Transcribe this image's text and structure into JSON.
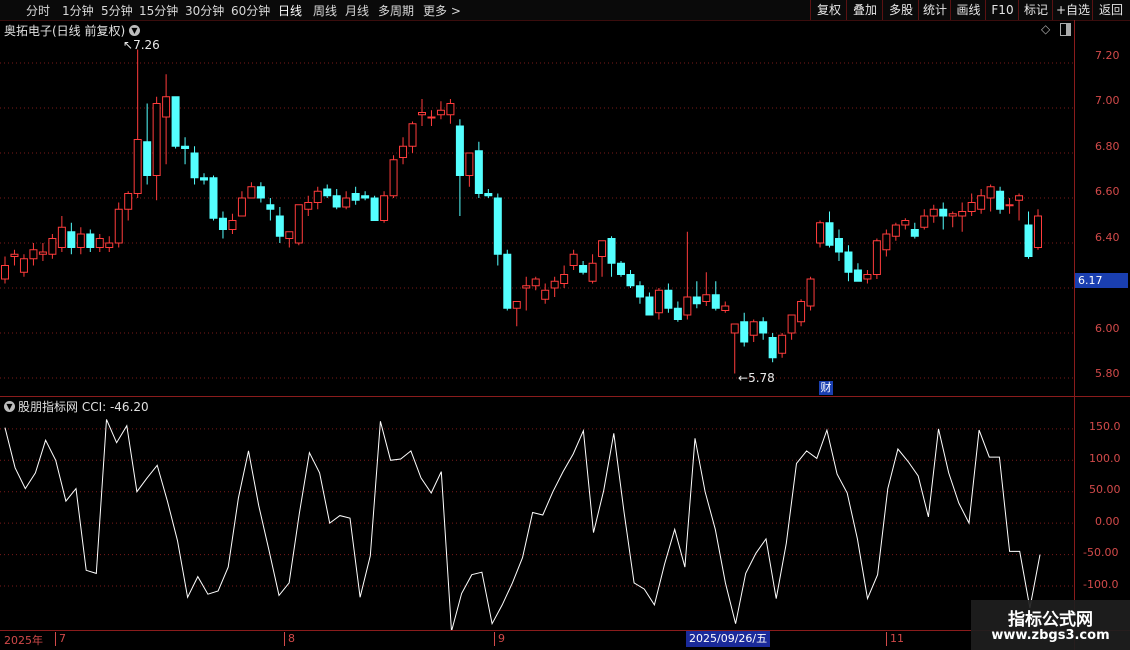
{
  "toolbar": {
    "timeframes": [
      "分时",
      "1分钟",
      "5分钟",
      "15分钟",
      "30分钟",
      "60分钟",
      "日线",
      "周线",
      "月线",
      "多周期",
      "更多 >"
    ],
    "active_timeframe": "日线",
    "right_buttons": [
      "复权",
      "叠加",
      "多股",
      "统计",
      "画线",
      "F10",
      "标记",
      "+自选",
      "返回"
    ]
  },
  "stock_title": "奥拓电子(日线 前复权)",
  "indicator_title": "股朋指标网  CCI: -46.20",
  "high_marker": "7.26",
  "low_marker": "5.78",
  "current_price_tag": "6.17",
  "fin_badge": "财",
  "price_axis_labels": [
    "7.20",
    "7.00",
    "6.80",
    "6.60",
    "6.40",
    "6.20",
    "6.00",
    "5.80"
  ],
  "cci_axis_labels": [
    "150.0",
    "100.0",
    "50.00",
    "0.00",
    "-50.00",
    "-100.0"
  ],
  "date_bar": {
    "year": "2025年",
    "months": [
      "7",
      "8",
      "9",
      "11"
    ],
    "highlight_date": "2025/09/26/五"
  },
  "watermark": {
    "line1": "指标公式网",
    "line2": "www.zbgs3.com"
  },
  "colors": {
    "up": "#ff3c3c",
    "down": "#54ffff",
    "cci": "#ffffff",
    "grid": "#7a1a1a"
  },
  "chart_data": [
    {
      "type": "candlestick",
      "title": "奥拓电子(日线 前复权)",
      "ylim": [
        5.72,
        7.32
      ],
      "annotations": [
        {
          "label": "7.26",
          "kind": "high"
        },
        {
          "label": "5.78",
          "kind": "low"
        }
      ],
      "candles": [
        [
          6.24,
          6.34,
          6.22,
          6.3
        ],
        [
          6.34,
          6.37,
          6.3,
          6.35
        ],
        [
          6.27,
          6.35,
          6.25,
          6.33
        ],
        [
          6.33,
          6.4,
          6.3,
          6.37
        ],
        [
          6.35,
          6.4,
          6.32,
          6.36
        ],
        [
          6.35,
          6.44,
          6.33,
          6.42
        ],
        [
          6.38,
          6.52,
          6.36,
          6.47
        ],
        [
          6.45,
          6.49,
          6.35,
          6.38
        ],
        [
          6.38,
          6.47,
          6.35,
          6.44
        ],
        [
          6.44,
          6.46,
          6.36,
          6.38
        ],
        [
          6.38,
          6.44,
          6.36,
          6.42
        ],
        [
          6.38,
          6.43,
          6.36,
          6.4
        ],
        [
          6.4,
          6.58,
          6.38,
          6.55
        ],
        [
          6.55,
          6.63,
          6.5,
          6.62
        ],
        [
          6.62,
          7.26,
          6.6,
          6.86
        ],
        [
          6.85,
          7.02,
          6.66,
          6.7
        ],
        [
          6.7,
          7.05,
          6.59,
          7.02
        ],
        [
          6.96,
          7.15,
          6.75,
          7.05
        ],
        [
          7.05,
          7.05,
          6.82,
          6.83
        ],
        [
          6.83,
          6.87,
          6.75,
          6.82
        ],
        [
          6.8,
          6.83,
          6.66,
          6.69
        ],
        [
          6.69,
          6.71,
          6.66,
          6.68
        ],
        [
          6.69,
          6.7,
          6.5,
          6.51
        ],
        [
          6.51,
          6.54,
          6.42,
          6.46
        ],
        [
          6.46,
          6.53,
          6.44,
          6.5
        ],
        [
          6.52,
          6.63,
          6.52,
          6.6
        ],
        [
          6.6,
          6.67,
          6.6,
          6.65
        ],
        [
          6.65,
          6.67,
          6.58,
          6.6
        ],
        [
          6.57,
          6.6,
          6.5,
          6.55
        ],
        [
          6.52,
          6.56,
          6.4,
          6.43
        ],
        [
          6.42,
          6.45,
          6.38,
          6.45
        ],
        [
          6.4,
          6.55,
          6.39,
          6.57
        ],
        [
          6.55,
          6.61,
          6.52,
          6.58
        ],
        [
          6.58,
          6.65,
          6.55,
          6.63
        ],
        [
          6.64,
          6.66,
          6.6,
          6.61
        ],
        [
          6.61,
          6.64,
          6.55,
          6.56
        ],
        [
          6.56,
          6.63,
          6.55,
          6.6
        ],
        [
          6.62,
          6.65,
          6.57,
          6.59
        ],
        [
          6.61,
          6.63,
          6.59,
          6.6
        ],
        [
          6.6,
          6.61,
          6.5,
          6.5
        ],
        [
          6.5,
          6.63,
          6.49,
          6.61
        ],
        [
          6.61,
          6.79,
          6.6,
          6.77
        ],
        [
          6.78,
          6.87,
          6.75,
          6.83
        ],
        [
          6.83,
          6.94,
          6.8,
          6.93
        ],
        [
          6.97,
          7.04,
          6.92,
          6.98
        ],
        [
          6.96,
          6.99,
          6.92,
          6.96
        ],
        [
          6.97,
          7.03,
          6.95,
          6.99
        ],
        [
          6.97,
          7.04,
          6.93,
          7.02
        ],
        [
          6.92,
          6.95,
          6.52,
          6.7
        ],
        [
          6.7,
          6.8,
          6.65,
          6.8
        ],
        [
          6.81,
          6.85,
          6.6,
          6.62
        ],
        [
          6.62,
          6.64,
          6.6,
          6.61
        ],
        [
          6.6,
          6.62,
          6.3,
          6.35
        ],
        [
          6.35,
          6.37,
          6.1,
          6.11
        ],
        [
          6.11,
          6.13,
          6.03,
          6.14
        ],
        [
          6.2,
          6.25,
          6.1,
          6.21
        ],
        [
          6.21,
          6.25,
          6.19,
          6.24
        ],
        [
          6.15,
          6.22,
          6.13,
          6.19
        ],
        [
          6.2,
          6.25,
          6.16,
          6.23
        ],
        [
          6.22,
          6.3,
          6.2,
          6.26
        ],
        [
          6.3,
          6.37,
          6.28,
          6.35
        ],
        [
          6.3,
          6.32,
          6.26,
          6.27
        ],
        [
          6.23,
          6.35,
          6.22,
          6.31
        ],
        [
          6.34,
          6.4,
          6.25,
          6.41
        ],
        [
          6.42,
          6.43,
          6.25,
          6.31
        ],
        [
          6.31,
          6.32,
          6.25,
          6.26
        ],
        [
          6.26,
          6.28,
          6.2,
          6.21
        ],
        [
          6.21,
          6.23,
          6.13,
          6.16
        ],
        [
          6.16,
          6.18,
          6.08,
          6.08
        ],
        [
          6.09,
          6.2,
          6.06,
          6.19
        ],
        [
          6.19,
          6.22,
          6.09,
          6.11
        ],
        [
          6.11,
          6.14,
          6.05,
          6.06
        ],
        [
          6.08,
          6.45,
          6.06,
          6.16
        ],
        [
          6.16,
          6.23,
          6.11,
          6.13
        ],
        [
          6.14,
          6.27,
          6.12,
          6.17
        ],
        [
          6.17,
          6.23,
          6.1,
          6.11
        ],
        [
          6.1,
          6.14,
          6.09,
          6.12
        ],
        [
          6.0,
          6.04,
          5.82,
          6.04
        ],
        [
          6.05,
          6.09,
          5.94,
          5.96
        ],
        [
          5.99,
          6.06,
          5.96,
          6.05
        ],
        [
          6.05,
          6.07,
          5.97,
          6.0
        ],
        [
          5.98,
          6.0,
          5.87,
          5.89
        ],
        [
          5.91,
          6.0,
          5.89,
          5.99
        ],
        [
          6.0,
          6.08,
          5.97,
          6.08
        ],
        [
          6.05,
          6.15,
          6.03,
          6.14
        ],
        [
          6.12,
          6.25,
          6.1,
          6.24
        ],
        [
          6.4,
          6.5,
          6.38,
          6.49
        ],
        [
          6.49,
          6.54,
          6.38,
          6.39
        ],
        [
          6.42,
          6.46,
          6.32,
          6.36
        ],
        [
          6.36,
          6.39,
          6.23,
          6.27
        ],
        [
          6.28,
          6.31,
          6.23,
          6.23
        ],
        [
          6.24,
          6.28,
          6.22,
          6.26
        ],
        [
          6.26,
          6.42,
          6.24,
          6.41
        ],
        [
          6.37,
          6.46,
          6.34,
          6.44
        ],
        [
          6.43,
          6.49,
          6.41,
          6.48
        ],
        [
          6.48,
          6.51,
          6.46,
          6.5
        ],
        [
          6.46,
          6.49,
          6.42,
          6.43
        ],
        [
          6.47,
          6.55,
          6.46,
          6.52
        ],
        [
          6.52,
          6.57,
          6.49,
          6.55
        ],
        [
          6.55,
          6.58,
          6.46,
          6.52
        ],
        [
          6.52,
          6.54,
          6.47,
          6.53
        ],
        [
          6.52,
          6.58,
          6.45,
          6.54
        ],
        [
          6.54,
          6.62,
          6.52,
          6.58
        ],
        [
          6.55,
          6.64,
          6.53,
          6.61
        ],
        [
          6.6,
          6.66,
          6.54,
          6.65
        ],
        [
          6.63,
          6.65,
          6.53,
          6.55
        ],
        [
          6.57,
          6.6,
          6.53,
          6.57
        ],
        [
          6.59,
          6.62,
          6.5,
          6.61
        ],
        [
          6.48,
          6.54,
          6.33,
          6.34
        ],
        [
          6.38,
          6.55,
          6.37,
          6.52
        ]
      ]
    },
    {
      "type": "line",
      "title": "股朋指标网  CCI: -46.20",
      "ylim": [
        -170,
        180
      ],
      "series": [
        {
          "name": "CCI",
          "values": [
            152,
            88,
            55,
            80,
            132,
            100,
            35,
            55,
            -75,
            -80,
            165,
            128,
            155,
            50,
            72,
            92,
            35,
            -28,
            -118,
            -85,
            -113,
            -108,
            -70,
            40,
            115,
            28,
            -42,
            -115,
            -95,
            15,
            112,
            80,
            0,
            12,
            8,
            -118,
            -52,
            162,
            100,
            102,
            115,
            72,
            48,
            82,
            -172,
            -112,
            -82,
            -78,
            -160,
            -130,
            -95,
            -55,
            17,
            13,
            50,
            82,
            110,
            147,
            -15,
            52,
            143,
            18,
            -95,
            -105,
            -130,
            -65,
            -10,
            -70,
            135,
            50,
            -10,
            -95,
            -160,
            -80,
            -48,
            -25,
            -120,
            -32,
            95,
            115,
            103,
            148,
            78,
            48,
            -25,
            -120,
            -82,
            55,
            118,
            98,
            75,
            10,
            150,
            80,
            32,
            0,
            148,
            105,
            105,
            -45,
            -45,
            -135,
            -50
          ]
        }
      ]
    }
  ]
}
